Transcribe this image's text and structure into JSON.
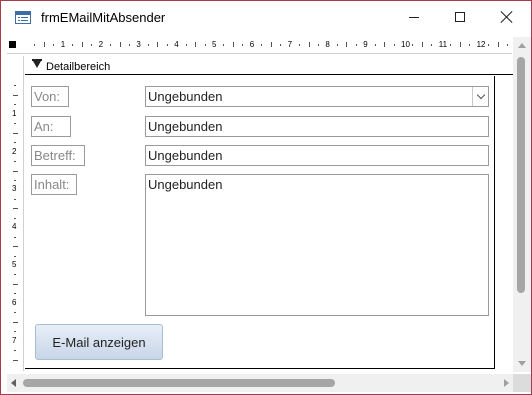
{
  "window": {
    "title": "frmEMailMitAbsender"
  },
  "ruler": {
    "top_numbers": [
      "1",
      "2",
      "3",
      "4",
      "5",
      "6",
      "7",
      "8",
      "9",
      "10",
      "11",
      "12"
    ],
    "left_numbers": [
      "1",
      "2",
      "3",
      "4",
      "5",
      "6",
      "7"
    ]
  },
  "section": {
    "label": "Detailbereich"
  },
  "form": {
    "von_label": "Von:",
    "von_value": "Ungebunden",
    "an_label": "An:",
    "an_value": "Ungebunden",
    "betreff_label": "Betreff:",
    "betreff_value": "Ungebunden",
    "inhalt_label": "Inhalt:",
    "inhalt_value": "Ungebunden",
    "button_label": "E-Mail anzeigen"
  },
  "icons": {
    "app": "form-icon",
    "minimize": "minimize-icon",
    "maximize": "maximize-icon",
    "close": "close-icon",
    "combo": "chevron-down-icon",
    "section": "section-arrow-icon"
  }
}
